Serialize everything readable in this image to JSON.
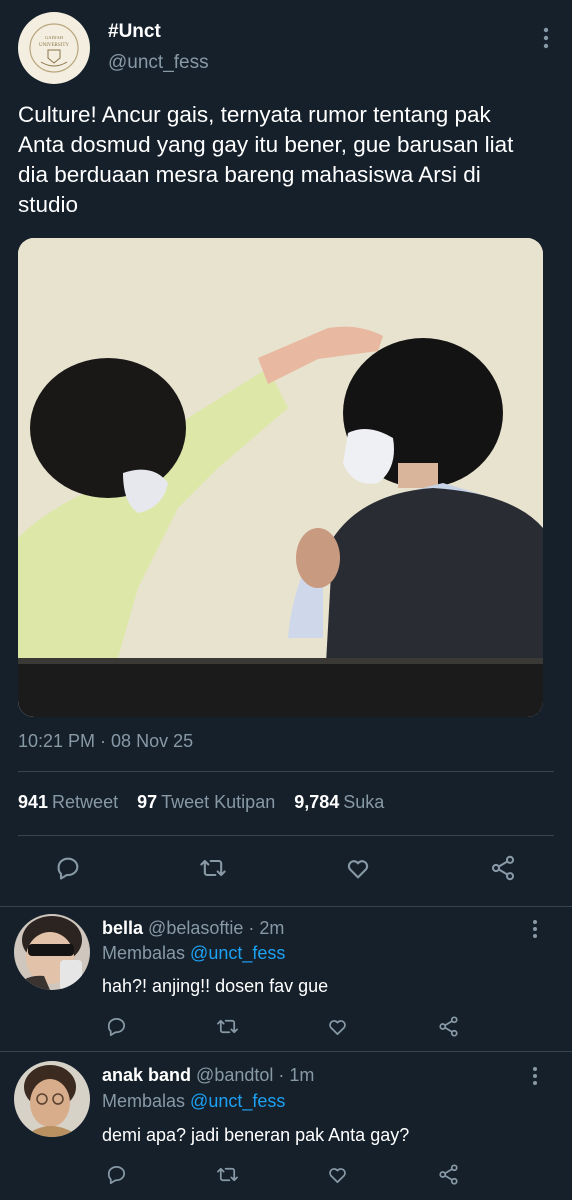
{
  "tweet": {
    "author_name": "#Unct",
    "author_handle": "@unct_fess",
    "avatar_logo_text": "GADJAH UNIVERSITY",
    "text": "Culture! Ancur gais, ternyata rumor tentang pak Anta dosmud yang gay itu bener, gue barusan liat dia berduaan mesra bareng mahasiswa Arsi di studio",
    "timestamp": "10:21 PM · 08 Nov 25",
    "stats": {
      "retweets": "941",
      "retweets_label": "Retweet",
      "quotes": "97",
      "quotes_label": "Tweet Kutipan",
      "likes": "9,784",
      "likes_label": "Suka"
    },
    "actions": [
      "reply-icon",
      "retweet-icon",
      "like-icon",
      "share-icon"
    ]
  },
  "replies": [
    {
      "name": "bella",
      "handle": "@belasoftie",
      "time": "· 2m",
      "replying_label": "Membalas",
      "replying_to": "@unct_fess",
      "text": "hah?! anjing!! dosen fav gue"
    },
    {
      "name": "anak band",
      "handle": "@bandtol",
      "time": "· 1m",
      "replying_label": "Membalas",
      "replying_to": "@unct_fess",
      "text": "demi apa? jadi beneran pak Anta gay?"
    }
  ],
  "colors": {
    "background": "#15202b",
    "text": "#ffffff",
    "muted": "#8899a6",
    "link": "#1da1f2",
    "divider": "#38444d"
  }
}
